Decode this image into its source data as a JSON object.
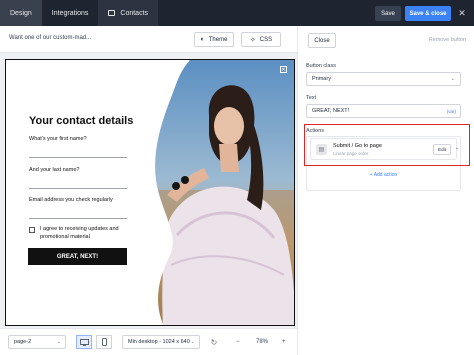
{
  "topbar": {
    "tabs": [
      {
        "label": "Design"
      },
      {
        "label": "Integrations"
      },
      {
        "label": "Contacts"
      }
    ],
    "save_label": "Save",
    "save_close_label": "Save & close",
    "close_glyph": "✕"
  },
  "toolbar": {
    "prompt_text": "Want one of our custom-mad...",
    "theme_label": "Theme",
    "css_label": "CSS"
  },
  "popup": {
    "title": "Your contact details",
    "first_name_label": "What's your first name?",
    "last_name_label": "And your last name?",
    "email_label": "Email address you check regularly",
    "consent_label": "I agree to receiving updates and promotional material",
    "button_label": "GREAT, NEXT!"
  },
  "bottombar": {
    "page_select": "page-2",
    "viewport_select": "Min desktop - 1024 x 640",
    "zoom": "78%",
    "zoom_minus": "−",
    "zoom_plus": "+"
  },
  "right_panel": {
    "close_label": "Close",
    "remove_label": "Remove button",
    "button_class_label": "Button class",
    "button_class_value": "Primary",
    "text_label": "Text",
    "text_value": "GREAT, NEXT!",
    "var_tag": "{var}",
    "actions_label": "Actions",
    "action_title": "Submit / Go to page",
    "action_subtitle": "Linear page order",
    "edit_label": "Edit",
    "add_action_label": "+ Add action"
  },
  "colors": {
    "topbar": "#1f2530",
    "accent": "#3b82f6",
    "highlight": "#dc2626"
  }
}
